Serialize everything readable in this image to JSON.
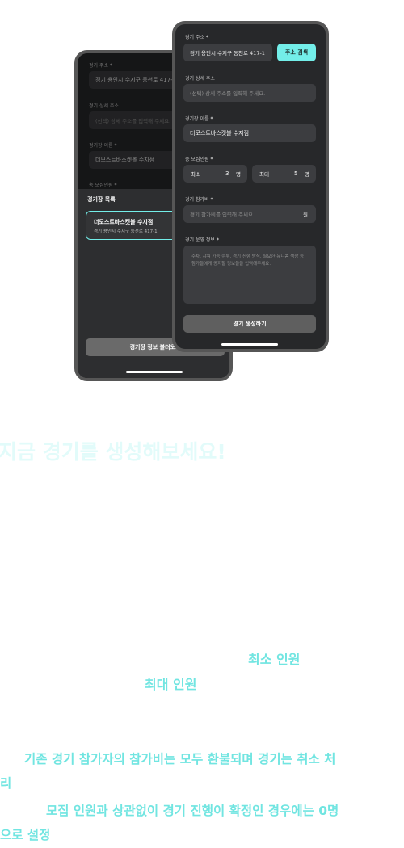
{
  "back_phone": {
    "address_label": "경기 주소",
    "address_value": "경기 용인시 수지구 동천로 417-1",
    "detail_label": "경기 상세 주소",
    "detail_placeholder": "(선택) 상세 주소를 입력해 주세요.",
    "venue_label": "경기장 이름",
    "venue_value": "더모스트바스켓볼 수지점",
    "recruit_label": "총 모집인원",
    "sheet_title": "경기장 목록",
    "venue_item_name": "더모스트바스켓볼 수지점",
    "venue_item_address": "경기 용인시 수지구 동천로 417-1",
    "load_button": "경기장 정보 불러오기"
  },
  "front_phone": {
    "address_label": "경기 주소",
    "address_value": "경기 용인시 수지구 동천로 417-1",
    "address_search_button": "주소 검색",
    "detail_label": "경기 상세 주소",
    "detail_placeholder": "(선택) 상세 주소를 입력해 주세요.",
    "venue_label": "경기장 이름",
    "venue_value": "더모스트바스켓볼 수지점",
    "recruit_label": "총 모집인원",
    "min_label": "최소",
    "min_value": "3",
    "max_label": "최대",
    "max_value": "5",
    "unit": "명",
    "fee_label": "경기 참가비",
    "fee_placeholder": "경기 참가비를 입력해 주세요.",
    "fee_unit": "원",
    "info_label": "경기 운영 정보",
    "info_placeholder": "주차, 샤워 가능 여부, 경기 진행 방식, 필요한 유니폼 색상 등 참가들에게 공지할 정보들을 입력해주세요.",
    "create_button": "경기 생성하기",
    "required_mark": "*"
  },
  "marketing": {
    "headline": "지금 경기를 생성해보세요!",
    "min_people": "최소 인원",
    "max_people": "최대 인원",
    "note1_line1": "기존 경기 참가자의 참가비는 모두 환불되며 경기는 취소 처",
    "note1_line2": "리",
    "note2_line1": "모집 인원과 상관없이 경기 진행이 확정인 경우에는 0명",
    "note2_line2": "으로 설정"
  },
  "colors": {
    "accent": "#73eee9",
    "headline": "#e2fbfa",
    "phone_bg": "#27282a"
  }
}
